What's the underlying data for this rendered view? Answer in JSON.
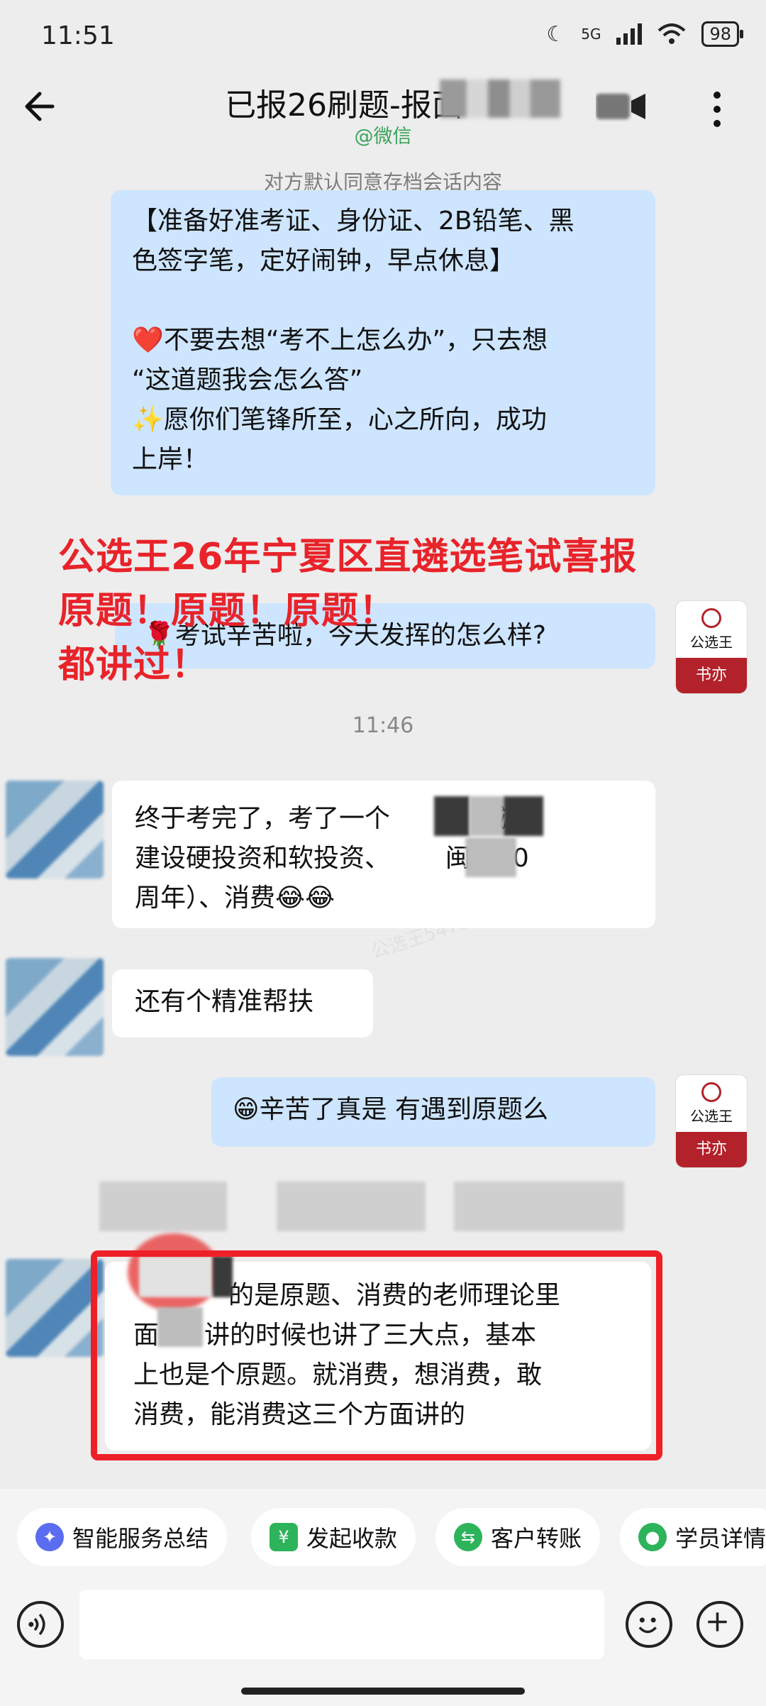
{
  "status": {
    "time": "11:51",
    "network": "5G",
    "battery": "98"
  },
  "header": {
    "title": "已报26刷题-报面",
    "subtitle": "@微信",
    "archive_note": "对方默认同意存档会话内容"
  },
  "messages": {
    "m1_line1": "【准备好准考证、身份证、2B铅笔、黑",
    "m1_line2": "色签字笔，定好闹钟，早点休息】",
    "m1_line3": "❤️不要去想“考不上怎么办”，只去想",
    "m1_line4": "“这道题我会怎么答”",
    "m1_line5": "✨愿你们笔锋所至，心之所向，成功",
    "m1_line6": "上岸！",
    "m2": "🌹考试辛苦啦，今天发挥的怎么样?",
    "time_divider": "11:46",
    "m3_line1a": "终于考完了，考了一个",
    "m3_line1b": "城市",
    "m3_line2a": "建设硬投资和软投资、",
    "m3_line2b": "闽宁30",
    "m3_line3": "周年）、消费😂😂",
    "m4": "还有个精准帮扶",
    "m5": "😁辛苦了真是  有遇到原题么",
    "m6_line1": "的是原题、消费的老师理论里",
    "m6_line2": "面",
    "m6_line2b": "讲的时候也讲了三大点，基本",
    "m6_line3": "上也是个原题。就消费，想消费，敢",
    "m6_line4": "消费，能消费这三个方面讲的"
  },
  "overlay": {
    "line1": "公选王26年宁夏区直遴选笔试喜报",
    "line2": "原题！原题！原题！",
    "line3": "都讲过！"
  },
  "brand_avatar": {
    "name": "公选王",
    "tag": "书亦"
  },
  "quick_actions": [
    {
      "label": "智能服务总结",
      "icon": "ai-summary-icon",
      "color": "#5a6cf0"
    },
    {
      "label": "发起收款",
      "icon": "yuan-icon",
      "color": "#2db35a"
    },
    {
      "label": "客户转账",
      "icon": "transfer-icon",
      "color": "#2db35a"
    },
    {
      "label": "学员详情",
      "icon": "student-icon",
      "color": "#2db35a"
    }
  ],
  "watermark": "公选王5473"
}
